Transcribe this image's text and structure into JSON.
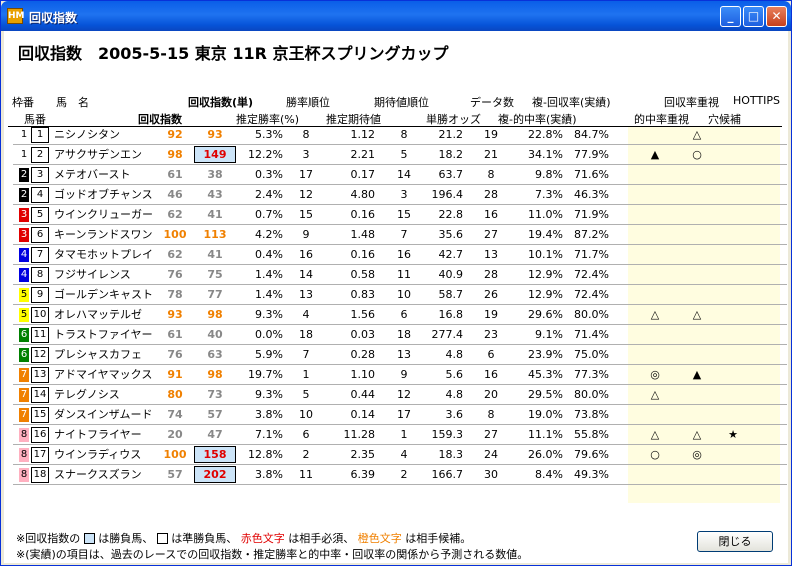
{
  "window": {
    "title": "回収指数"
  },
  "race_title": "回収指数　2005-5-15 東京 11R 京王杯スプリングカップ",
  "headers": {
    "waku": "枠番",
    "horse": "馬　名",
    "umaban": "馬番",
    "index_single": "回収指数(単)",
    "index": "回収指数",
    "win_rank": "勝率順位",
    "est_win_rate": "推定勝率(%)",
    "exp_rank": "期待値順位",
    "est_exp": "推定期待値",
    "data_count": "データ数",
    "win_odds": "単勝オッズ",
    "hit_recovery": "複-回収率(実績)",
    "hit_rate_actual": "複-的中率(実績)",
    "recovery_focus": "回収率重視",
    "hottips": "HOTTIPS",
    "hit_focus": "的中率重視",
    "longshot": "穴候補"
  },
  "waku_colors": {
    "1": "#ffffff",
    "2": "#000000",
    "3": "#e00000",
    "4": "#0000e0",
    "5": "#ffff00",
    "6": "#008000",
    "7": "#f08000",
    "8": "#ffb0c0"
  },
  "rows": [
    {
      "waku": "1",
      "no": "1",
      "name": "ニシノシタン",
      "v1": "92",
      "v2": "93",
      "v1c": "o",
      "v2c": "o",
      "box": false,
      "rate": "5.3%",
      "wr": "8",
      "ev": "1.12",
      "er": "8",
      "odds": "21.2",
      "dc": "19",
      "hit": "22.8%",
      "rec": "84.7%",
      "m1": "",
      "m2": "△",
      "m3": ""
    },
    {
      "waku": "1",
      "no": "2",
      "name": "アサクサデンエン",
      "v1": "98",
      "v2": "149",
      "v1c": "o",
      "v2c": "r",
      "box": true,
      "rate": "12.2%",
      "wr": "3",
      "ev": "2.21",
      "er": "5",
      "odds": "18.2",
      "dc": "21",
      "hit": "34.1%",
      "rec": "77.9%",
      "m1": "▲",
      "m2": "○",
      "m3": ""
    },
    {
      "waku": "2",
      "no": "3",
      "name": "メテオバースト",
      "v1": "61",
      "v2": "38",
      "v1c": "",
      "v2c": "",
      "box": false,
      "rate": "0.3%",
      "wr": "17",
      "ev": "0.17",
      "er": "14",
      "odds": "63.7",
      "dc": "8",
      "hit": "9.8%",
      "rec": "71.6%",
      "m1": "",
      "m2": "",
      "m3": ""
    },
    {
      "waku": "2",
      "no": "4",
      "name": "ゴッドオブチャンス",
      "v1": "46",
      "v2": "43",
      "v1c": "",
      "v2c": "",
      "box": false,
      "rate": "2.4%",
      "wr": "12",
      "ev": "4.80",
      "er": "3",
      "odds": "196.4",
      "dc": "28",
      "hit": "7.3%",
      "rec": "46.3%",
      "m1": "",
      "m2": "",
      "m3": ""
    },
    {
      "waku": "3",
      "no": "5",
      "name": "ウインクリューガー",
      "v1": "62",
      "v2": "41",
      "v1c": "",
      "v2c": "",
      "box": false,
      "rate": "0.7%",
      "wr": "15",
      "ev": "0.16",
      "er": "15",
      "odds": "22.8",
      "dc": "16",
      "hit": "11.0%",
      "rec": "71.9%",
      "m1": "",
      "m2": "",
      "m3": ""
    },
    {
      "waku": "3",
      "no": "6",
      "name": "キーンランドスワン",
      "v1": "100",
      "v2": "113",
      "v1c": "o",
      "v2c": "o",
      "box": false,
      "rate": "4.2%",
      "wr": "9",
      "ev": "1.48",
      "er": "7",
      "odds": "35.6",
      "dc": "27",
      "hit": "19.4%",
      "rec": "87.2%",
      "m1": "",
      "m2": "",
      "m3": ""
    },
    {
      "waku": "4",
      "no": "7",
      "name": "タマモホットプレイ",
      "v1": "62",
      "v2": "41",
      "v1c": "",
      "v2c": "",
      "box": false,
      "rate": "0.4%",
      "wr": "16",
      "ev": "0.16",
      "er": "16",
      "odds": "42.7",
      "dc": "13",
      "hit": "10.1%",
      "rec": "71.7%",
      "m1": "",
      "m2": "",
      "m3": ""
    },
    {
      "waku": "4",
      "no": "8",
      "name": "フジサイレンス",
      "v1": "76",
      "v2": "75",
      "v1c": "",
      "v2c": "",
      "box": false,
      "rate": "1.4%",
      "wr": "14",
      "ev": "0.58",
      "er": "11",
      "odds": "40.9",
      "dc": "28",
      "hit": "12.9%",
      "rec": "72.4%",
      "m1": "",
      "m2": "",
      "m3": ""
    },
    {
      "waku": "5",
      "no": "9",
      "name": "ゴールデンキャスト",
      "v1": "78",
      "v2": "77",
      "v1c": "",
      "v2c": "",
      "box": false,
      "rate": "1.4%",
      "wr": "13",
      "ev": "0.83",
      "er": "10",
      "odds": "58.7",
      "dc": "26",
      "hit": "12.9%",
      "rec": "72.4%",
      "m1": "",
      "m2": "",
      "m3": ""
    },
    {
      "waku": "5",
      "no": "10",
      "name": "オレハマッテルゼ",
      "v1": "93",
      "v2": "98",
      "v1c": "o",
      "v2c": "o",
      "box": false,
      "rate": "9.3%",
      "wr": "4",
      "ev": "1.56",
      "er": "6",
      "odds": "16.8",
      "dc": "19",
      "hit": "29.6%",
      "rec": "80.0%",
      "m1": "△",
      "m2": "△",
      "m3": ""
    },
    {
      "waku": "6",
      "no": "11",
      "name": "トラストファイヤー",
      "v1": "61",
      "v2": "40",
      "v1c": "",
      "v2c": "",
      "box": false,
      "rate": "0.0%",
      "wr": "18",
      "ev": "0.03",
      "er": "18",
      "odds": "277.4",
      "dc": "23",
      "hit": "9.1%",
      "rec": "71.4%",
      "m1": "",
      "m2": "",
      "m3": ""
    },
    {
      "waku": "6",
      "no": "12",
      "name": "プレシャスカフェ",
      "v1": "76",
      "v2": "63",
      "v1c": "",
      "v2c": "",
      "box": false,
      "rate": "5.9%",
      "wr": "7",
      "ev": "0.28",
      "er": "13",
      "odds": "4.8",
      "dc": "6",
      "hit": "23.9%",
      "rec": "75.0%",
      "m1": "",
      "m2": "",
      "m3": ""
    },
    {
      "waku": "7",
      "no": "13",
      "name": "アドマイヤマックス",
      "v1": "91",
      "v2": "98",
      "v1c": "o",
      "v2c": "o",
      "box": false,
      "rate": "19.7%",
      "wr": "1",
      "ev": "1.10",
      "er": "9",
      "odds": "5.6",
      "dc": "16",
      "hit": "45.3%",
      "rec": "77.3%",
      "m1": "◎",
      "m2": "▲",
      "m3": ""
    },
    {
      "waku": "7",
      "no": "14",
      "name": "テレグノシス",
      "v1": "80",
      "v2": "73",
      "v1c": "o",
      "v2c": "",
      "box": false,
      "rate": "9.3%",
      "wr": "5",
      "ev": "0.44",
      "er": "12",
      "odds": "4.8",
      "dc": "20",
      "hit": "29.5%",
      "rec": "80.0%",
      "m1": "△",
      "m2": "",
      "m3": ""
    },
    {
      "waku": "7",
      "no": "15",
      "name": "ダンスインザムード",
      "v1": "74",
      "v2": "57",
      "v1c": "",
      "v2c": "",
      "box": false,
      "rate": "3.8%",
      "wr": "10",
      "ev": "0.14",
      "er": "17",
      "odds": "3.6",
      "dc": "8",
      "hit": "19.0%",
      "rec": "73.8%",
      "m1": "",
      "m2": "",
      "m3": ""
    },
    {
      "waku": "8",
      "no": "16",
      "name": "ナイトフライヤー",
      "v1": "20",
      "v2": "47",
      "v1c": "",
      "v2c": "",
      "box": false,
      "rate": "7.1%",
      "wr": "6",
      "ev": "11.28",
      "er": "1",
      "odds": "159.3",
      "dc": "27",
      "hit": "11.1%",
      "rec": "55.8%",
      "m1": "△",
      "m2": "△",
      "m3": "★"
    },
    {
      "waku": "8",
      "no": "17",
      "name": "ウインラディウス",
      "v1": "100",
      "v2": "158",
      "v1c": "o",
      "v2c": "r",
      "box": true,
      "rate": "12.8%",
      "wr": "2",
      "ev": "2.35",
      "er": "4",
      "odds": "18.3",
      "dc": "24",
      "hit": "26.0%",
      "rec": "79.6%",
      "m1": "○",
      "m2": "◎",
      "m3": ""
    },
    {
      "waku": "8",
      "no": "18",
      "name": "スナークスズラン",
      "v1": "57",
      "v2": "202",
      "v1c": "",
      "v2c": "r",
      "box": true,
      "rate": "3.8%",
      "wr": "11",
      "ev": "6.39",
      "er": "2",
      "odds": "166.7",
      "dc": "30",
      "hit": "8.4%",
      "rec": "49.3%",
      "m1": "",
      "m2": "",
      "m3": ""
    }
  ],
  "footer": {
    "line1_a": "※回収指数の",
    "line1_b": "は勝負馬、",
    "line1_c": "は準勝負馬、",
    "line1_d": "赤色文字",
    "line1_e": "は相手必須、",
    "line1_f": "橙色文字",
    "line1_g": "は相手候補。",
    "line2": "※(実績)の項目は、過去のレースでの回収指数・推定勝率と的中率・回収率の関係から予測される数値。"
  },
  "close_button": "閉じる"
}
